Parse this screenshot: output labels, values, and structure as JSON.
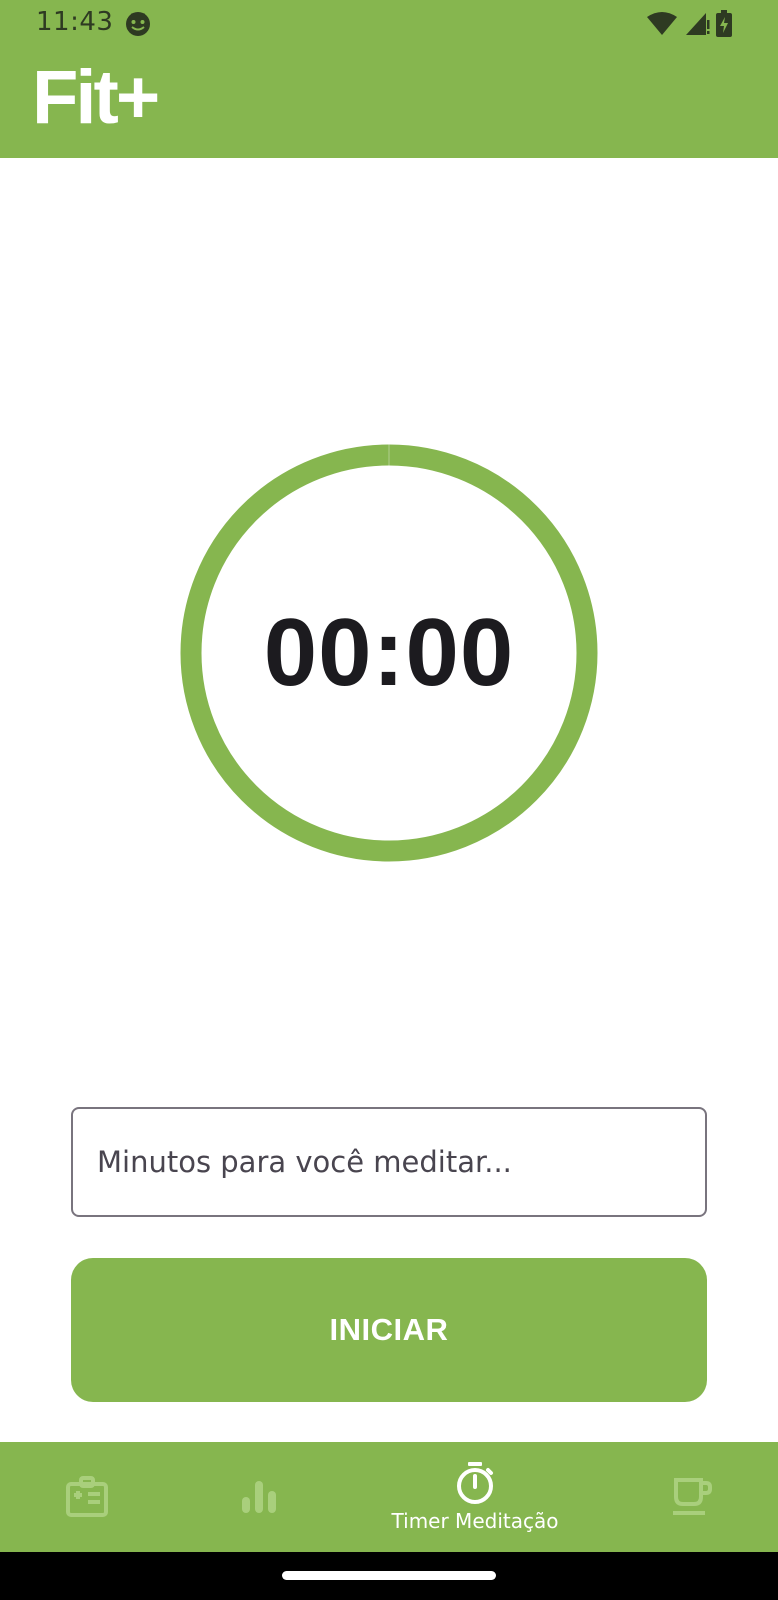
{
  "status_bar": {
    "time": "11:43",
    "icons": [
      "app-notification-icon",
      "wifi-icon",
      "cell-signal-icon",
      "battery-charging-icon"
    ]
  },
  "app_bar": {
    "title": "Fit+"
  },
  "timer": {
    "display": "00:00",
    "progress": 1.0
  },
  "minutes_input": {
    "placeholder": "Minutos para você meditar...",
    "value": ""
  },
  "start_button": {
    "label": "INICIAR"
  },
  "bottom_nav": {
    "items": [
      {
        "icon": "medical-card-icon",
        "label": "",
        "selected": false
      },
      {
        "icon": "bar-chart-icon",
        "label": "",
        "selected": false
      },
      {
        "icon": "timer-icon",
        "label": "Timer Meditação",
        "selected": true
      },
      {
        "icon": "coffee-cup-icon",
        "label": "",
        "selected": false
      }
    ]
  },
  "colors": {
    "brand_green": "#86b64f",
    "nav_unselected": "#a9cf7c",
    "text_dark": "#1c1b1f",
    "white": "#ffffff"
  }
}
